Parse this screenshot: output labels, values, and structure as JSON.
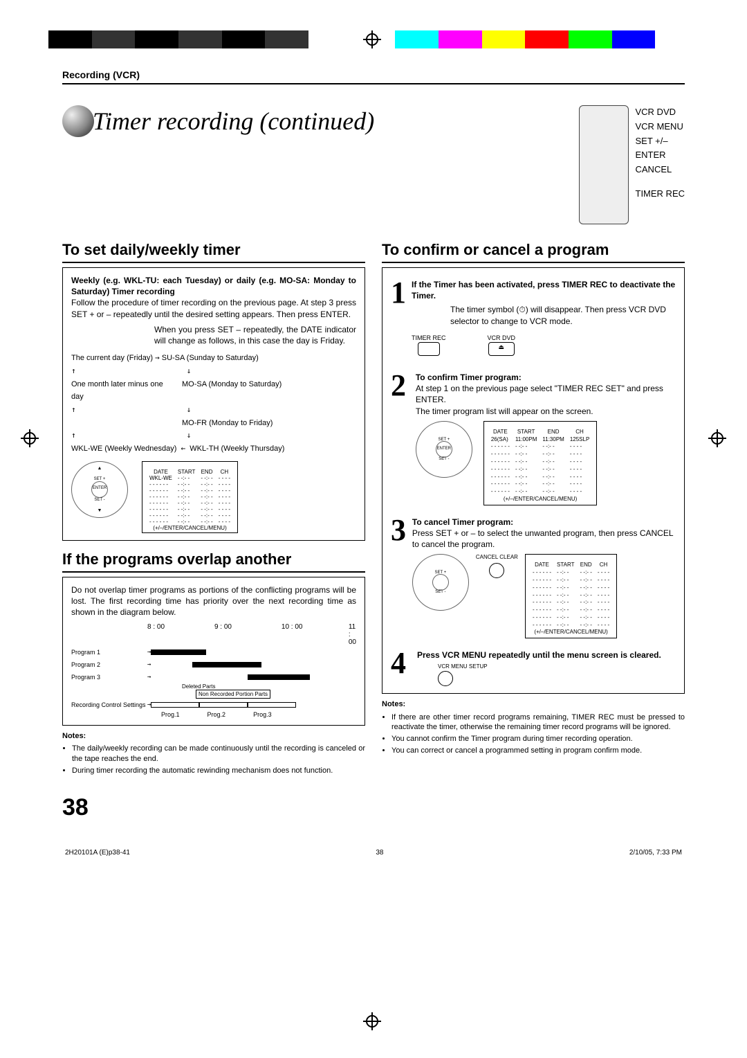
{
  "header": {
    "section": "Recording (VCR)"
  },
  "title": "Timer recording (continued)",
  "remote_labels": [
    "VCR DVD",
    "VCR MENU",
    "SET +/–",
    "ENTER",
    "CANCEL",
    "TIMER REC"
  ],
  "sections": {
    "set_timer": {
      "heading": "To set daily/weekly timer",
      "intro_bold": "Weekly (e.g. WKL-TU: each Tuesday) or daily (e.g. MO-SA: Monday to Saturday) Timer recording",
      "body1": "Follow the procedure of timer recording on the previous page. At step 3 press SET + or – repeatedly until the desired setting appears. Then press ENTER.",
      "body2": "When you press SET – repeatedly, the DATE indicator will change as follows, in this case the day is Friday.",
      "flow": {
        "current": "The current day (Friday)",
        "su_sa": "SU-SA (Sunday to Saturday)",
        "one_month": "One month later minus one day",
        "mo_sa": "MO-SA (Monday to Saturday)",
        "mo_fr": "MO-FR (Monday to Friday)",
        "wkl_we": "WKL-WE (Weekly Wednesday)",
        "wkl_th": "WKL-TH (Weekly Thursday)"
      },
      "table_header": [
        "DATE",
        "START",
        "END",
        "CH"
      ],
      "table_first": "WKL-WE",
      "table_footer": "(+/–/ENTER/CANCEL/MENU)"
    },
    "overlap": {
      "heading": "If the programs overlap another",
      "body": "Do not overlap timer programs as portions of the conflicting programs will be lost. The first recording time has priority over the next recording time as shown in the diagram below.",
      "times": [
        "8 : 00",
        "9 : 00",
        "10 : 00",
        "11 : 00"
      ],
      "rows": [
        "Program 1",
        "Program 2",
        "Program 3",
        "Recording Control Settings"
      ],
      "deleted": "Deleted Parts",
      "nonrec": "Non Recorded Portion Parts",
      "progs": [
        "Prog.1",
        "Prog.2",
        "Prog.3"
      ],
      "notes_label": "Notes:",
      "notes": [
        "The daily/weekly recording can be made continuously until the recording is canceled or the tape reaches the end.",
        "During timer recording the automatic rewinding mechanism does not function."
      ]
    },
    "confirm": {
      "heading": "To confirm or cancel a program",
      "step1_bold": "If the Timer has been activated, press TIMER REC to deactivate the Timer.",
      "step1_body_pre": "The timer symbol (",
      "step1_body_post": ") will disappear. Then press VCR DVD selector to change to VCR mode.",
      "timer_rec_label": "TIMER REC",
      "vcr_dvd_label": "VCR DVD",
      "step2_bold": "To confirm Timer program:",
      "step2_body": "At step 1 on the previous page select \"TIMER REC SET\" and press ENTER.",
      "step2_body2": "The timer program list will appear on the screen.",
      "step3_bold": "To cancel Timer program:",
      "step3_body": "Press SET + or – to select the unwanted program, then press CANCEL to cancel the program.",
      "cancel_clear": "CANCEL CLEAR",
      "step4_bold": "Press VCR MENU repeatedly until the menu screen is cleared.",
      "vcr_menu_label": "VCR MENU SETUP",
      "table2_header": [
        "DATE",
        "START",
        "END",
        "CH"
      ],
      "table2_row": [
        "26(SA)",
        "11:00PM",
        "11:30PM",
        "125SLP"
      ],
      "table_footer": "(+/–/ENTER/CANCEL/MENU)",
      "notes_label": "Notes:",
      "notes": [
        "If there are other timer record programs remaining, TIMER REC must be pressed to reactivate the timer, otherwise the remaining timer record programs will be ignored.",
        "You cannot confirm the Timer program during timer recording operation.",
        "You can correct or cancel a programmed setting in program confirm mode."
      ]
    }
  },
  "page_number": "38",
  "footer": {
    "left": "2H20101A (E)p38-41",
    "mid": "38",
    "right": "2/10/05, 7:33 PM"
  },
  "colorbar": [
    "#000",
    "#333",
    "#000",
    "#333",
    "#000",
    "#333",
    "#fff",
    "#fff",
    "#0ff",
    "#f0f",
    "#ff0",
    "#f00",
    "#0f0",
    "#00f",
    "#fff"
  ]
}
